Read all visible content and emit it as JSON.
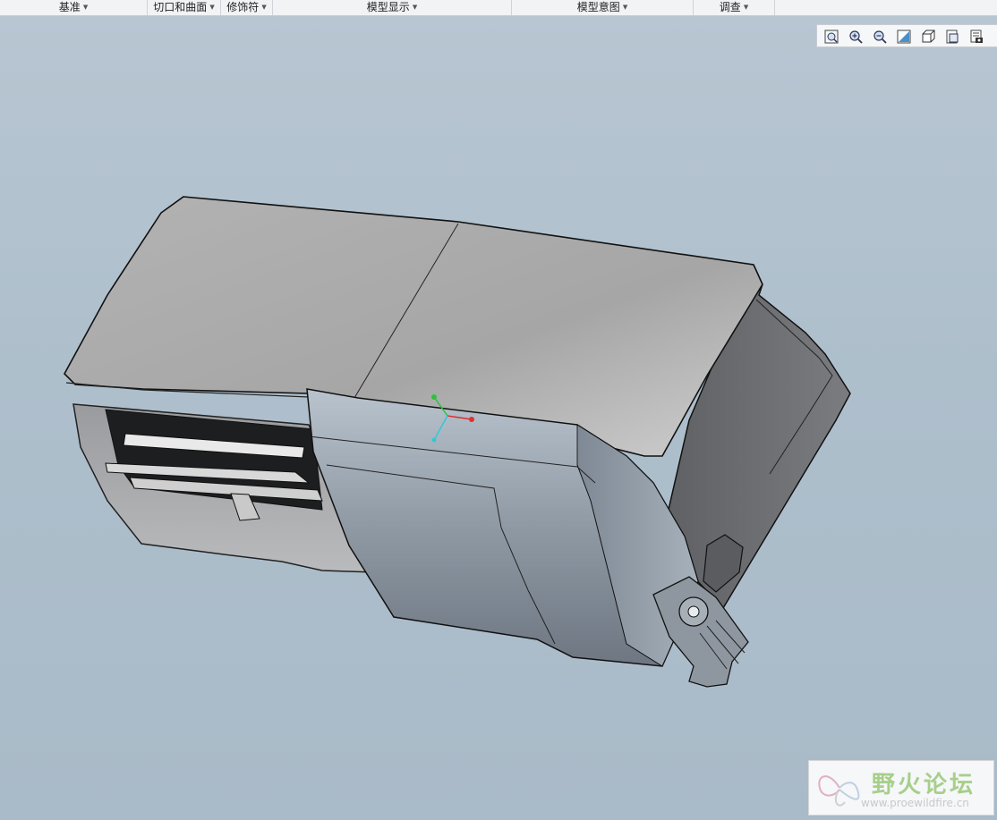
{
  "ribbon": {
    "groups": [
      {
        "label": "基准"
      },
      {
        "label": "切口和曲面"
      },
      {
        "label": "修饰符"
      },
      {
        "label": "模型显示"
      },
      {
        "label": "模型意图"
      },
      {
        "label": "调查"
      }
    ]
  },
  "view_toolbar": {
    "buttons": [
      {
        "icon": "zoom-refit-icon"
      },
      {
        "icon": "zoom-in-icon"
      },
      {
        "icon": "zoom-out-icon"
      },
      {
        "icon": "repaint-icon"
      },
      {
        "icon": "display-style-icon"
      },
      {
        "icon": "saved-views-icon"
      },
      {
        "icon": "view-manager-icon"
      }
    ]
  },
  "watermark": {
    "title": "野火论坛",
    "url": "www.proewildfire.cn"
  },
  "colors": {
    "background": "#aebfcc",
    "model_top": "#aaaaaa",
    "model_side": "#6b6d70",
    "axis_x": "#e03030",
    "axis_y": "#30c040",
    "axis_z": "#30c8d8"
  }
}
